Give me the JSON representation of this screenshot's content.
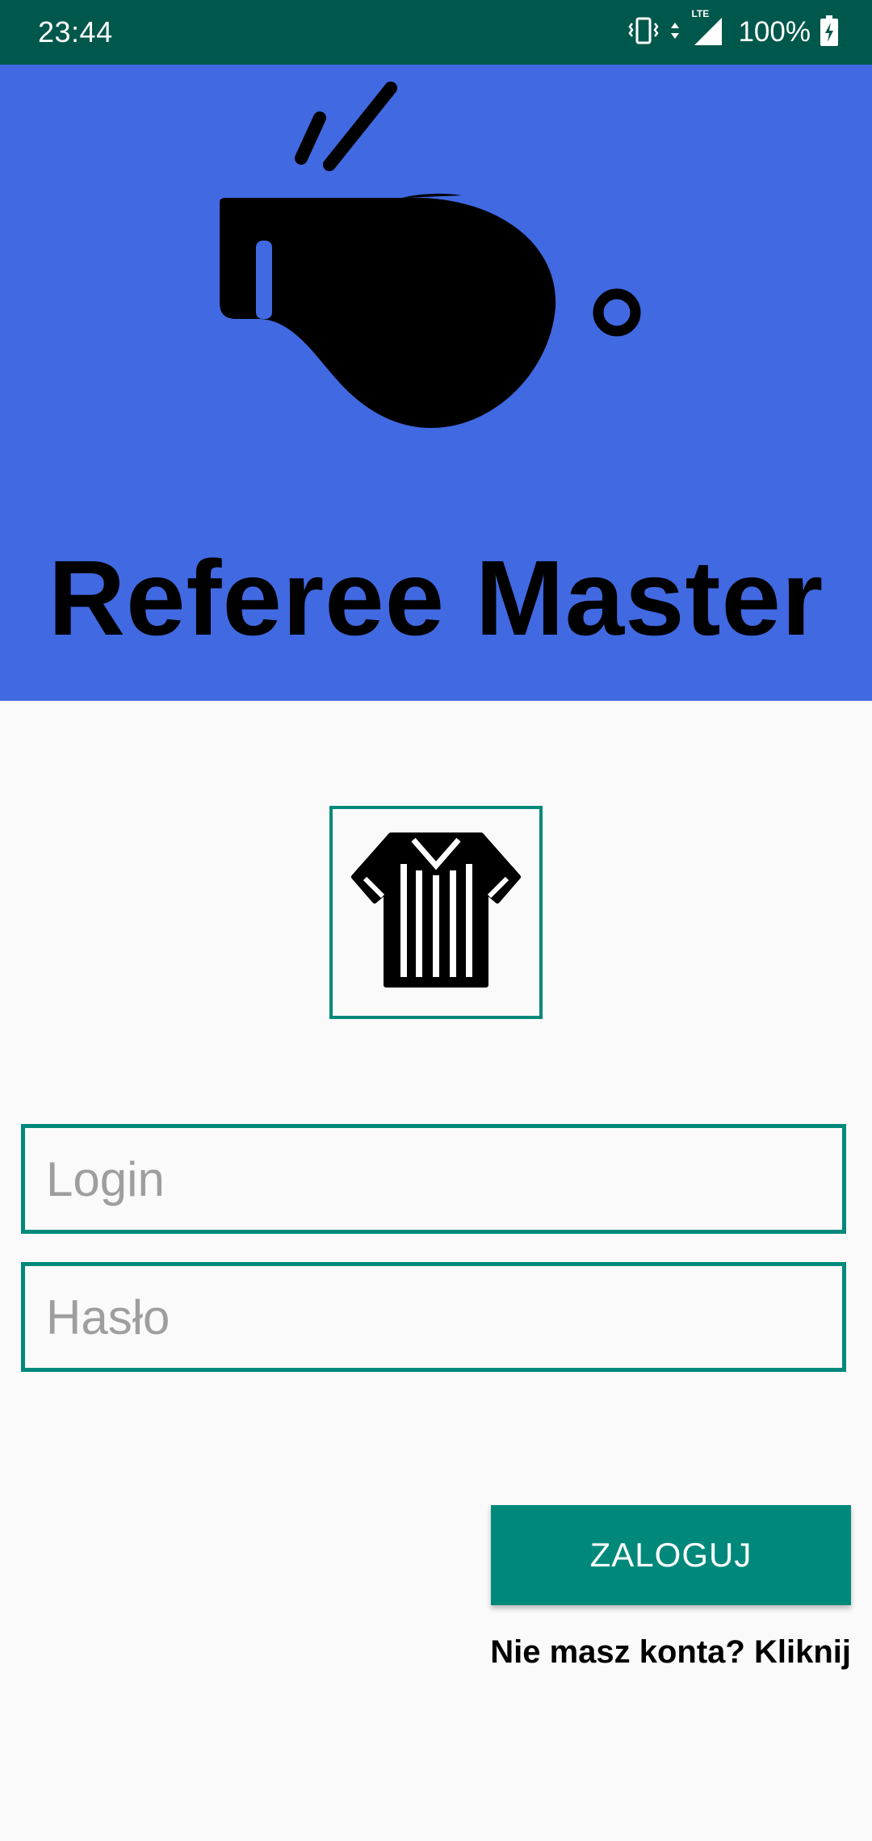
{
  "status_bar": {
    "time": "23:44",
    "battery_percent": "100%",
    "network_badge": "LTE",
    "icons": [
      "vibrate-icon",
      "data-arrows-icon",
      "signal-icon",
      "battery-charging-icon"
    ]
  },
  "header": {
    "title": "Referee Master",
    "background_color": "#4169e1",
    "logo_icon": "whistle-icon"
  },
  "login_form": {
    "avatar_icon": "referee-jersey-icon",
    "login_placeholder": "Login",
    "password_placeholder": "Hasło",
    "submit_label": "ZALOGUJ",
    "register_prompt": "Nie masz konta? Kliknij",
    "accent_color": "#00897b"
  }
}
